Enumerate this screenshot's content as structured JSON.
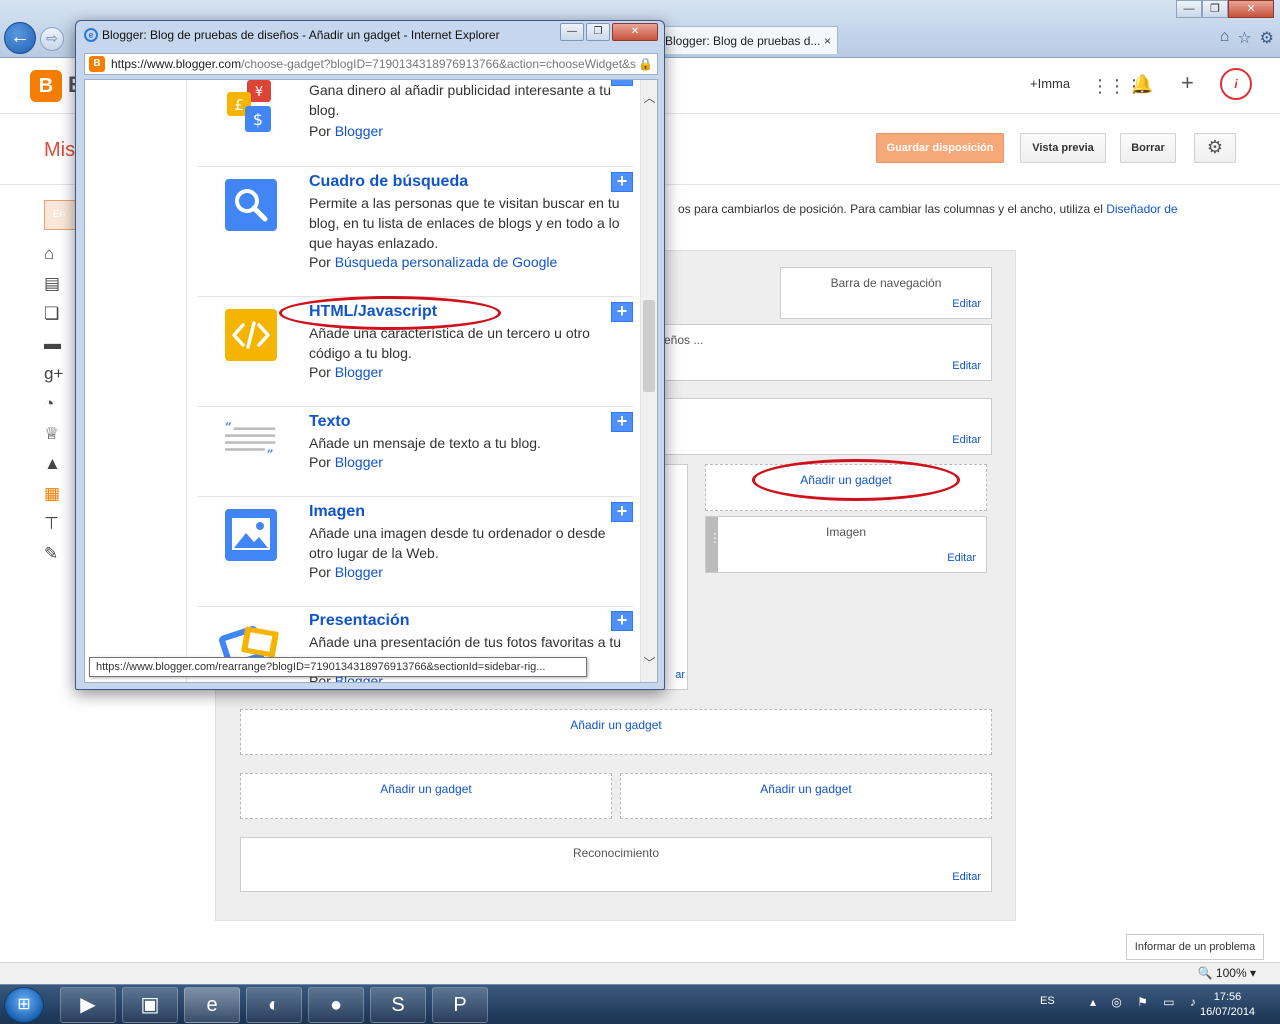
{
  "browser": {
    "back_glyph": "←",
    "forward_glyph": "⇨",
    "tab_title": "Blogger: Blog de pruebas d...",
    "tab_close": "×",
    "window_controls": [
      "—",
      "❐",
      "✕"
    ],
    "right_icons": [
      "home-icon",
      "star-icon",
      "gear-icon"
    ],
    "zoom_label": "100%"
  },
  "blogger": {
    "logo_letter": "B",
    "logo_text": "B",
    "user": "+Imma",
    "apps_glyph": "⋮⋮⋮",
    "bell_glyph": "🔔",
    "plus_glyph": "+",
    "avatar_letter": "i",
    "page_title": "Mis",
    "buttons": {
      "save": "Guardar disposición",
      "preview": "Vista previa",
      "delete": "Borrar",
      "gear": "⚙"
    },
    "side_button_label": "En",
    "info_text": "os para cambiarlos de posición. Para cambiar las columnas y el ancho, utiliza el ",
    "info_link": "Diseñador de",
    "sidebar_icons": [
      "home-icon",
      "posts-icon",
      "pages-icon",
      "comments-icon",
      "google-plus-icon",
      "stats-icon",
      "earnings-icon",
      "campaigns-icon",
      "layout-icon",
      "template-icon",
      "settings-icon"
    ],
    "layout": {
      "navbar_title": "Barra de navegación",
      "header_partial": "eños ...",
      "edit_label": "Editar",
      "add_gadget": "Añadir un gadget",
      "image_gadget": "Imagen",
      "recognition": "Reconocimiento",
      "hidden_edit": "ar"
    },
    "report_problem": "Informar de un problema"
  },
  "popup": {
    "title": "Blogger: Blog de pruebas de diseños - Añadir un gadget - Internet Explorer",
    "url_host": "https://www.blogger.com",
    "url_path": "/choose-gadget?blogID=7190134318976913766&action=chooseWidget&s",
    "controls": [
      "—",
      "❐",
      "✕"
    ],
    "add_glyph": "+",
    "gadgets": [
      {
        "name": "",
        "desc": "Gana dinero al añadir publicidad interesante a tu blog.",
        "by_prefix": "Por ",
        "by": "Blogger"
      },
      {
        "name": "Cuadro de búsqueda",
        "desc": "Permite a las personas que te visitan buscar en tu blog, en tu lista de enlaces de blogs y en todo a lo que hayas enlazado.",
        "by_prefix": "Por ",
        "by": "Búsqueda personalizada de Google"
      },
      {
        "name": "HTML/Javascript",
        "desc": "Añade una característica de un tercero u otro código a tu blog.",
        "by_prefix": "Por ",
        "by": "Blogger"
      },
      {
        "name": "Texto",
        "desc": "Añade un mensaje de texto a tu blog.",
        "by_prefix": "Por ",
        "by": "Blogger"
      },
      {
        "name": "Imagen",
        "desc": "Añade una imagen desde tu ordenador o desde otro lugar de la Web.",
        "by_prefix": "Por ",
        "by": "Blogger"
      },
      {
        "name": "Presentación",
        "desc": "Añade una presentación de tus fotos favoritas a tu blog.",
        "by_prefix": "Por ",
        "by": "Blogger"
      }
    ],
    "status_url": "https://www.blogger.com/rearrange?blogID=7190134318976913766&sectionId=sidebar-rig..."
  },
  "taskbar": {
    "start_glyph": "⊞",
    "apps": [
      "media-player-icon",
      "explorer-icon",
      "internet-explorer-icon",
      "app-icon",
      "firefox-icon",
      "skype-icon",
      "powerpoint-icon"
    ],
    "lang": "ES",
    "time": "17:56",
    "date": "16/07/2014"
  },
  "colors": {
    "blogger_orange": "#f57d00",
    "link_blue": "#1155cc",
    "annotation_red": "#d0101a"
  }
}
